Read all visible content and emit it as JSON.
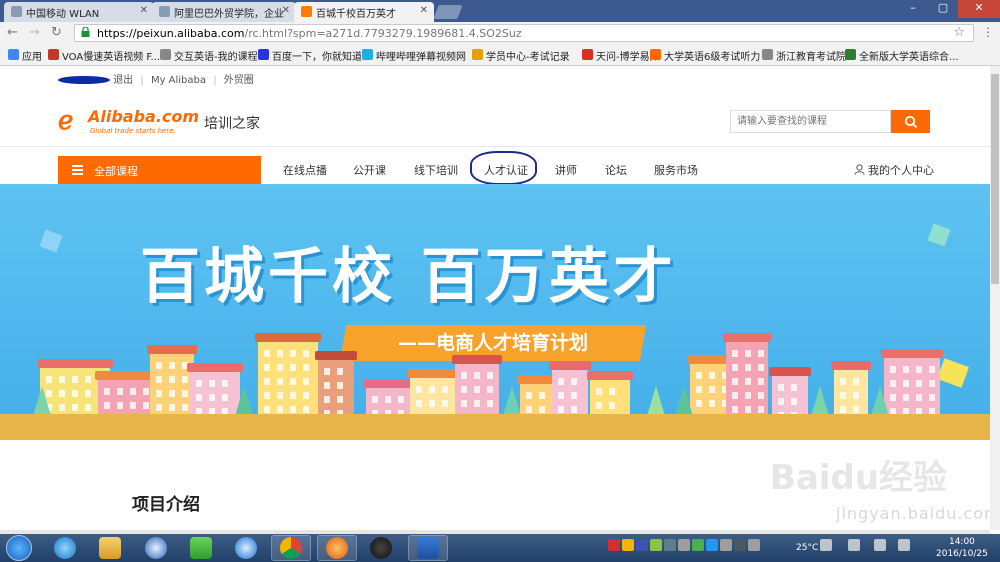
{
  "browser": {
    "tabs": [
      {
        "title": "中国移动 WLAN"
      },
      {
        "title": "阿里巴巴外贸学院，企业"
      },
      {
        "title": "百城千校百万英才",
        "active": true
      }
    ],
    "url_host": "https://peixun.alibaba.com",
    "url_rest": "/rc.html?spm=a271d.7793279.1989681.4.SO2Suz",
    "bookmarks": [
      {
        "label": "应用",
        "color": "#4285f4"
      },
      {
        "label": "VOA慢速英语视频 F...",
        "color": "#c0392b"
      },
      {
        "label": "交互英语-我的课程",
        "color": "#888888"
      },
      {
        "label": "百度一下，你就知道",
        "color": "#2932e1"
      },
      {
        "label": "哔哩哔哩弹幕视频网",
        "color": "#23ade5"
      },
      {
        "label": "学员中心-考试记录",
        "color": "#e6a100"
      },
      {
        "label": "天问-博学易知",
        "color": "#d93025"
      },
      {
        "label": "大学英语6级考试听力",
        "color": "#ff6a00"
      },
      {
        "label": "浙江教育考试院",
        "color": "#888888"
      },
      {
        "label": "全新版大学英语综合...",
        "color": "#2e7d32"
      }
    ]
  },
  "site": {
    "topbar": {
      "logout": "退出",
      "my_alibaba": "My Alibaba",
      "foreign_trade": "外贸圈"
    },
    "logo_name": "Alibaba.com",
    "logo_tagline": "Global trade starts here.",
    "site_title": "培训之家",
    "search_placeholder": "请输入要查找的课程",
    "all_courses": "全部课程",
    "nav": [
      "在线点播",
      "公开课",
      "线下培训",
      "人才认证",
      "讲师",
      "论坛",
      "服务市场"
    ],
    "personal_center": "我的个人中心",
    "banner": {
      "slogan": "百城千校 百万英才",
      "subtitle": "——电商人才培育计划"
    },
    "section_title": "项目介绍"
  },
  "watermark": {
    "text": "Baidu经验",
    "url": "jingyan.baidu.com"
  },
  "taskbar": {
    "temperature": "25°C",
    "time": "14:00",
    "date": "2016/10/25"
  },
  "colors": {
    "accent": "#ff6a00",
    "banner_sky": "#4fb8ee",
    "highlight_ring": "#1f2a8c"
  }
}
